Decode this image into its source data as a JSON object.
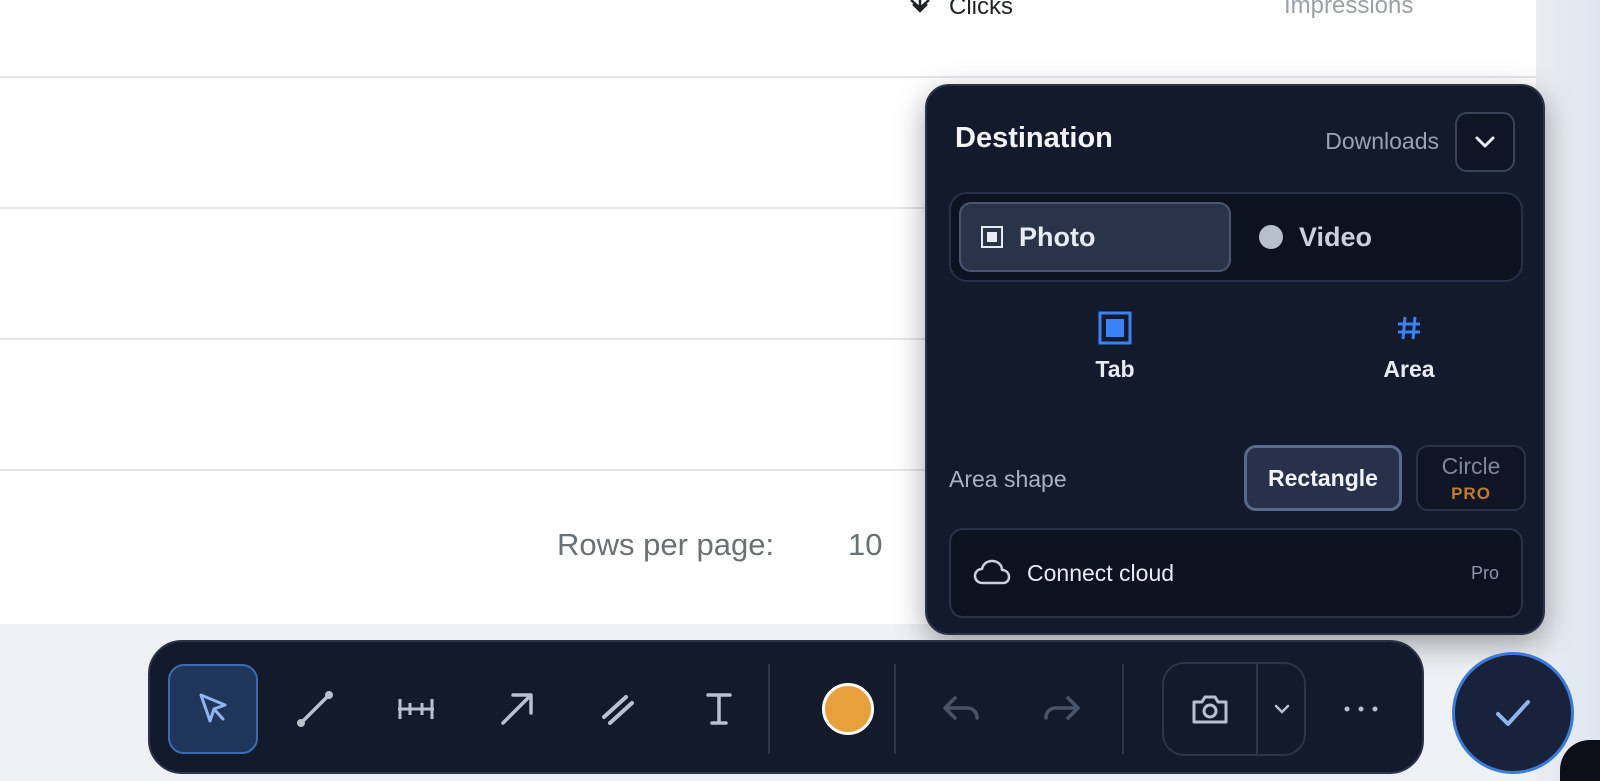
{
  "background": {
    "columns": {
      "clicks": "Clicks",
      "impressions": "Impressions"
    },
    "pagination": {
      "rows_label": "Rows per page:",
      "rows_value": "10"
    }
  },
  "panel": {
    "title": "Destination",
    "destination_value": "Downloads",
    "modes": {
      "photo": "Photo",
      "video": "Video",
      "selected": "Photo"
    },
    "targets": {
      "tab": "Tab",
      "area": "Area"
    },
    "shape": {
      "label": "Area shape",
      "rectangle": "Rectangle",
      "circle": "Circle",
      "circle_badge": "PRO",
      "selected": "Rectangle"
    },
    "cloud": {
      "label": "Connect cloud",
      "badge": "Pro"
    }
  },
  "toolbar": {
    "tools": [
      "select-tool",
      "line-tool",
      "measure-tool",
      "arrow-tool",
      "highlighter-tool",
      "text-tool"
    ],
    "active_tool": "select-tool",
    "current_color": "#e8a03a",
    "undo_enabled": false,
    "redo_enabled": false,
    "more_label": "···"
  },
  "colors": {
    "panel_bg": "#131a2b",
    "accent_blue": "#3a7ad9",
    "pro_orange": "#c27c2a"
  }
}
